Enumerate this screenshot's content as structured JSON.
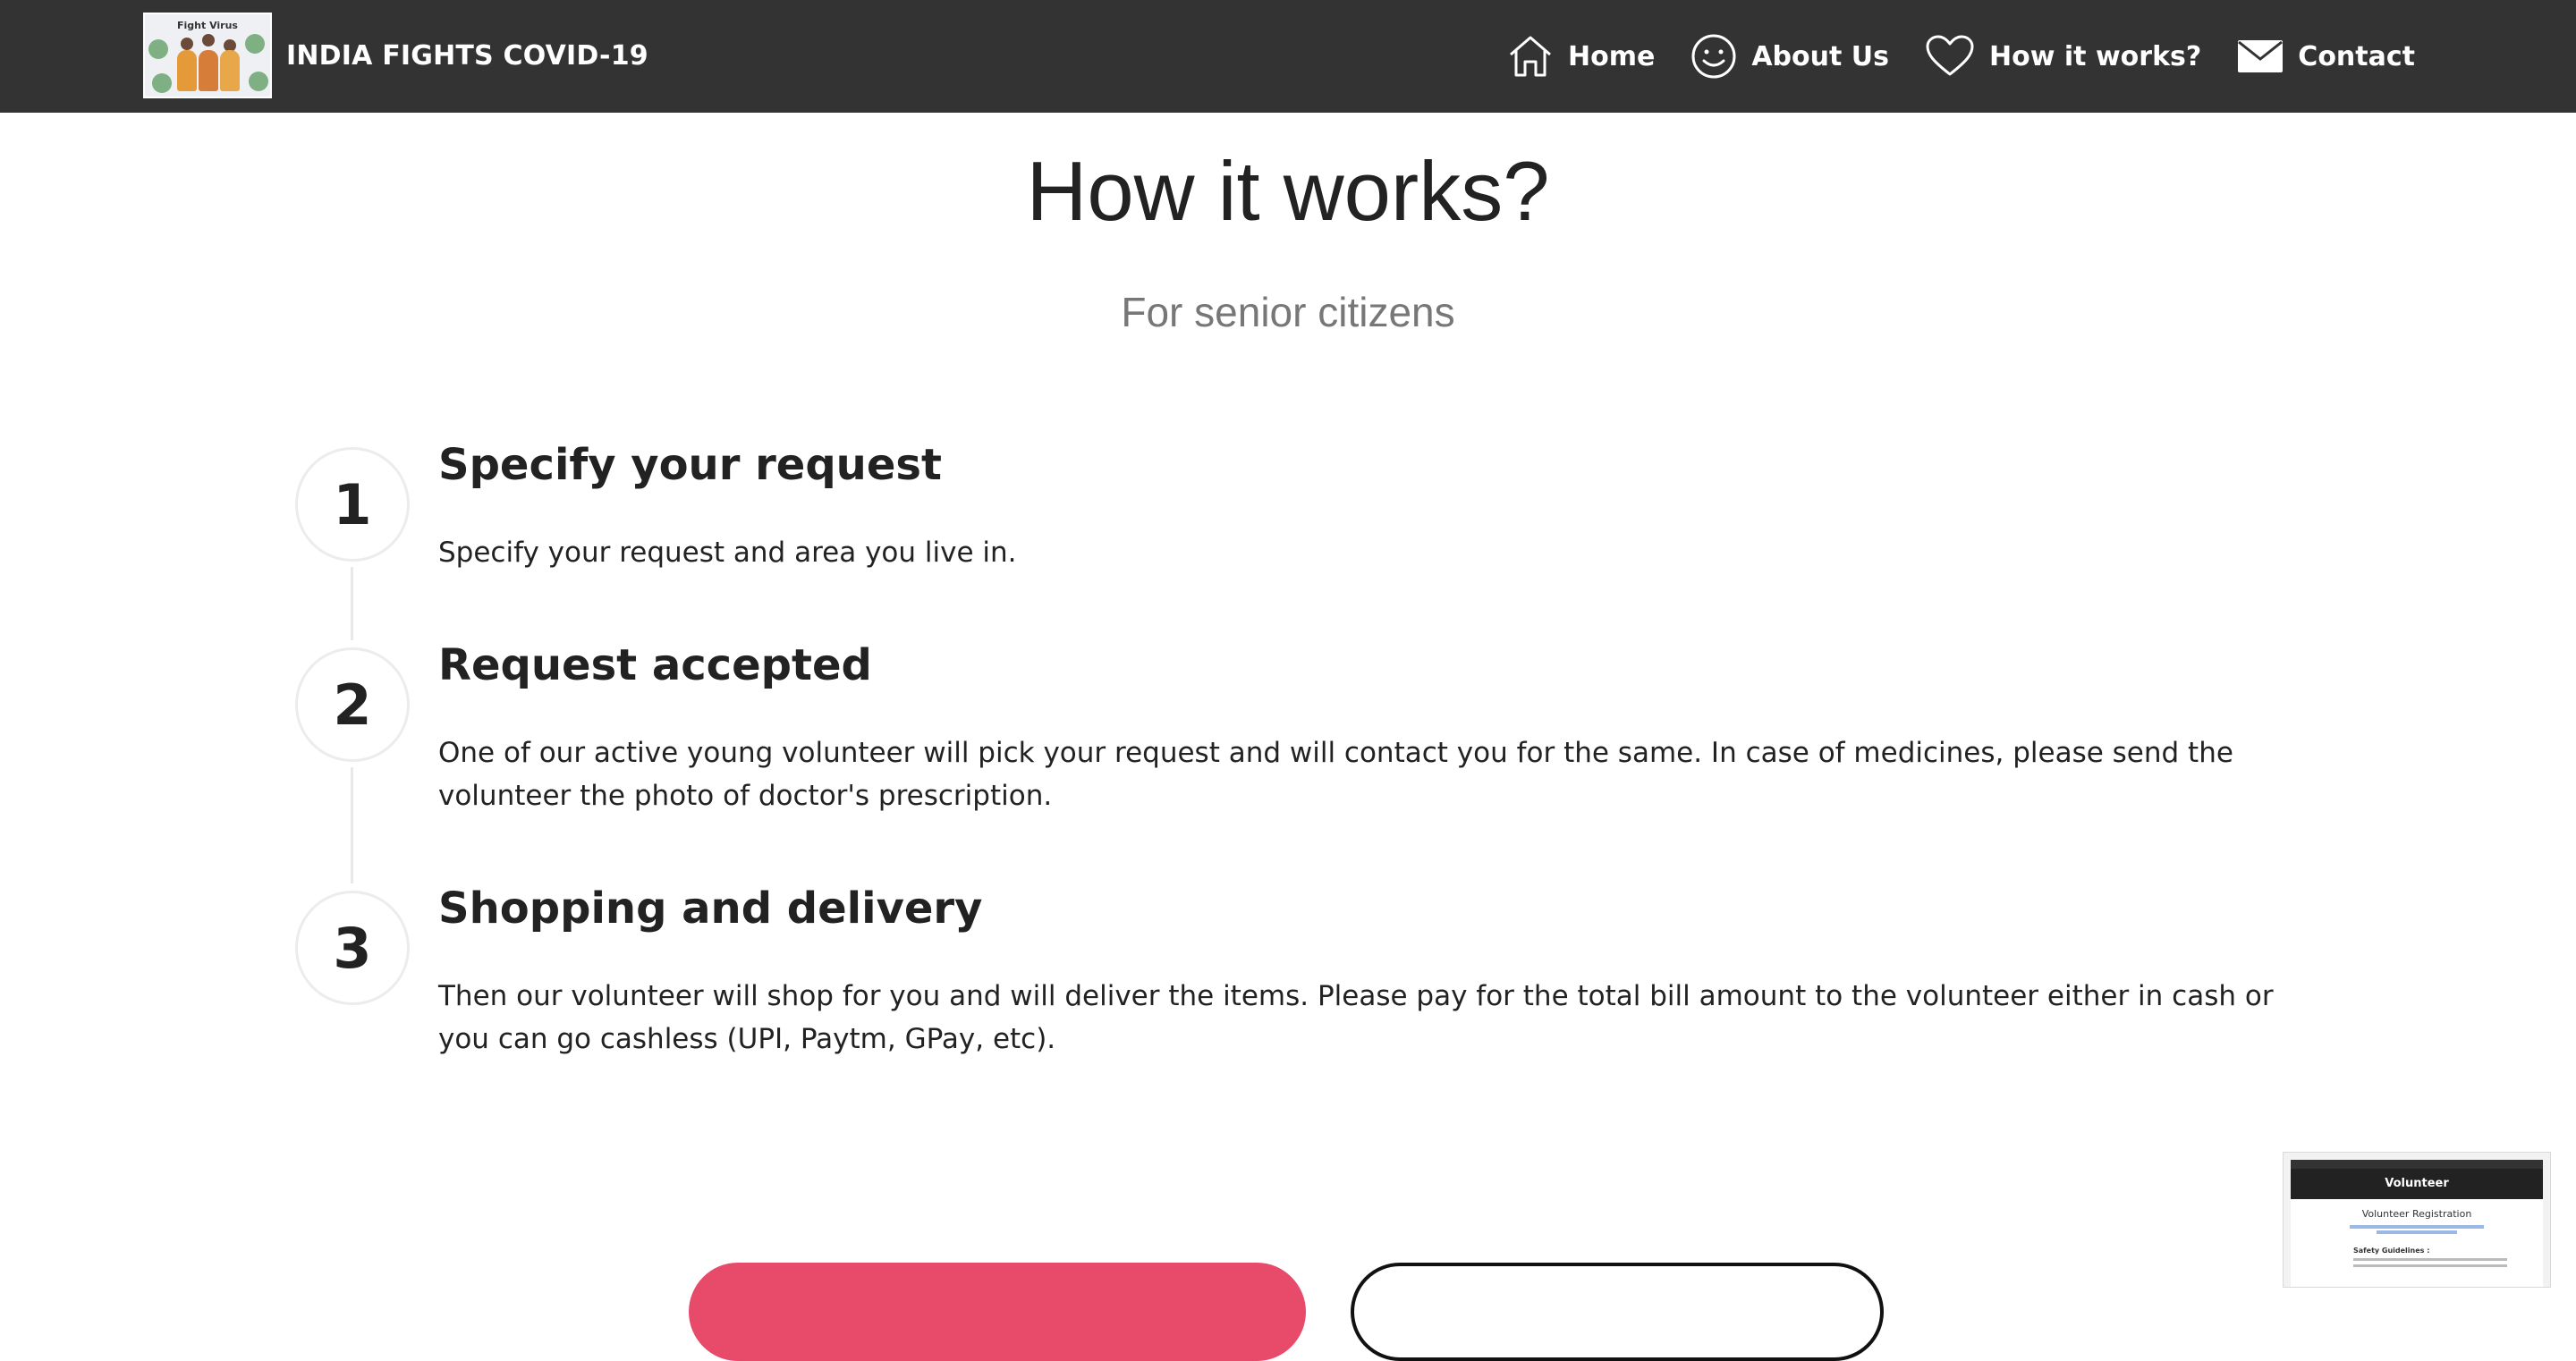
{
  "brand": {
    "logo_text": "Fight Virus",
    "title": "INDIA FIGHTS COVID-19"
  },
  "nav": {
    "items": [
      {
        "label": "Home",
        "icon": "home-icon"
      },
      {
        "label": "About Us",
        "icon": "smiley-icon"
      },
      {
        "label": "How it works?",
        "icon": "heart-icon"
      },
      {
        "label": "Contact",
        "icon": "mail-icon"
      }
    ]
  },
  "main": {
    "title": "How it works?",
    "subtitle": "For senior citizens",
    "steps": [
      {
        "number": "1",
        "title": "Specify your request",
        "description": "Specify your request and area you live in."
      },
      {
        "number": "2",
        "title": "Request accepted",
        "description": "One of our active young volunteer will pick your request and will contact you for the same. In case of medicines, please send the volunteer the photo of doctor's prescription."
      },
      {
        "number": "3",
        "title": "Shopping and delivery",
        "description": "Then our volunteer will shop for you and will deliver the items. Please pay for the total bill amount to the volunteer either in cash or you can go cashless (UPI, Paytm, GPay, etc)."
      }
    ]
  },
  "thumbnail": {
    "banner": "Volunteer",
    "heading": "Volunteer Registration",
    "section": "Safety Guidelines :"
  },
  "colors": {
    "navbar": "#333333",
    "primary_button": "#e84a6a",
    "subtitle": "#777777"
  }
}
